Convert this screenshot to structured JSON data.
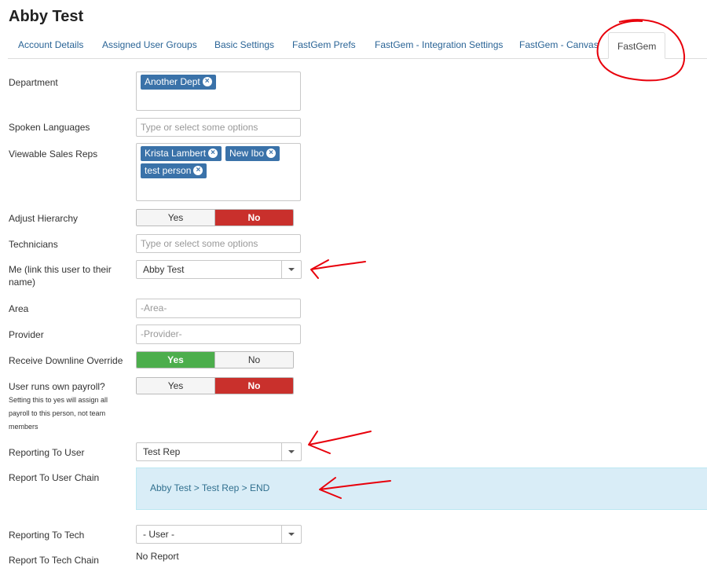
{
  "page_title": "Abby Test",
  "tabs": [
    {
      "label": "Account Details"
    },
    {
      "label": "Assigned User Groups"
    },
    {
      "label": "Basic Settings"
    },
    {
      "label": "FastGem Prefs"
    },
    {
      "label": "FastGem - Integration Settings"
    },
    {
      "label": "FastGem - Canvas"
    },
    {
      "label": "FastGem",
      "active": true
    }
  ],
  "fields": {
    "department": {
      "label": "Department",
      "chips": [
        "Another Dept"
      ]
    },
    "spoken_languages": {
      "label": "Spoken Languages",
      "placeholder": "Type or select some options"
    },
    "viewable_sales_reps": {
      "label": "Viewable Sales Reps",
      "chips": [
        "Krista Lambert",
        "New Ibo",
        "test person"
      ]
    },
    "adjust_hierarchy": {
      "label": "Adjust Hierarchy",
      "yes": "Yes",
      "no": "No",
      "selected": "No"
    },
    "technicians": {
      "label": "Technicians",
      "placeholder": "Type or select some options"
    },
    "me": {
      "label": "Me (link this user to their name)",
      "value": "Abby Test"
    },
    "area": {
      "label": "Area",
      "placeholder": "-Area-"
    },
    "provider": {
      "label": "Provider",
      "placeholder": "-Provider-"
    },
    "receive_downline_override": {
      "label": "Receive Downline Override",
      "yes": "Yes",
      "no": "No",
      "selected": "Yes"
    },
    "user_runs_own_payroll": {
      "label": "User runs own payroll?",
      "help": "Setting this to yes will assign all payroll to this person, not team members",
      "yes": "Yes",
      "no": "No",
      "selected": "No"
    },
    "reporting_to_user": {
      "label": "Reporting To User",
      "value": "Test Rep"
    },
    "report_to_user_chain": {
      "label": "Report To User Chain",
      "value": "Abby Test > Test Rep > END"
    },
    "reporting_to_tech": {
      "label": "Reporting To Tech",
      "value": "- User -"
    },
    "report_to_tech_chain": {
      "label": "Report To Tech Chain",
      "value": "No Report"
    }
  },
  "icons": {
    "chip_remove": "close-circle-icon",
    "dropdown": "caret-down-icon"
  },
  "colors": {
    "chip": "#3a72a9",
    "toggle_no": "#c9302c",
    "toggle_yes": "#4cae4c",
    "info_bg": "#d9edf7",
    "annotation": "#e8000b"
  }
}
